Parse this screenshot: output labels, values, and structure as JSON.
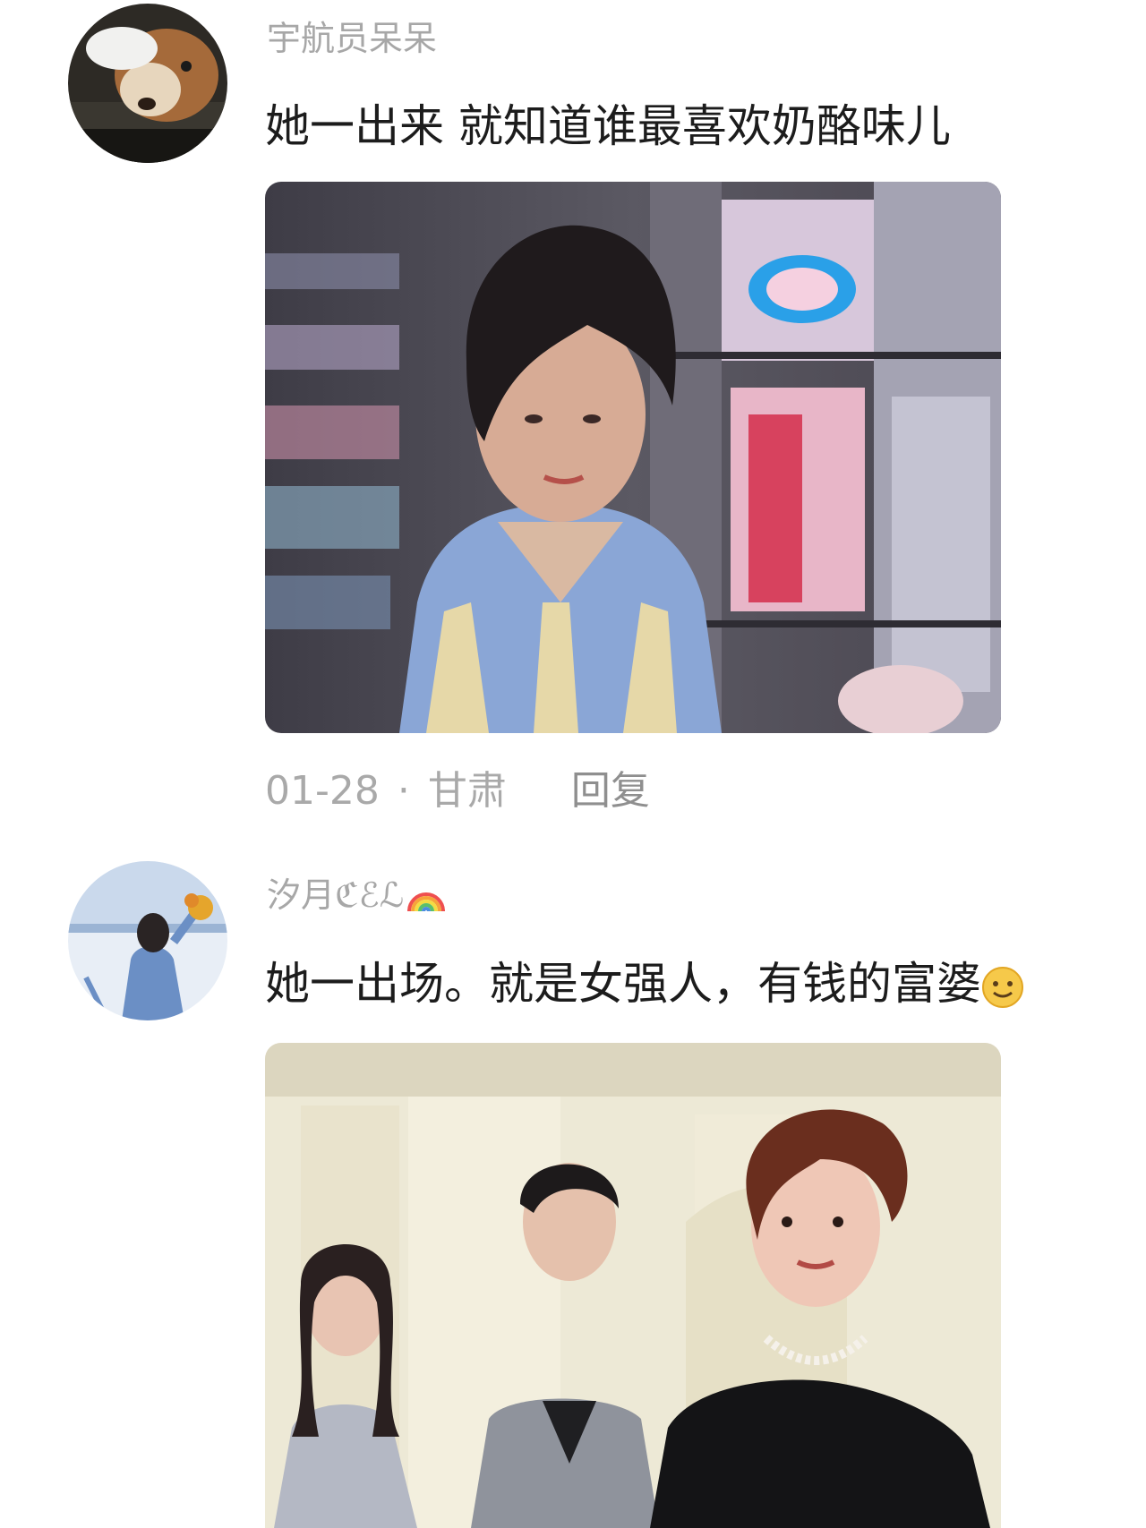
{
  "comments": [
    {
      "username": "宇航员呆呆",
      "avatar_icon": "dog-avatar",
      "text": "她一出来 就知道谁最喜欢奶酪味儿",
      "date": "01-28",
      "separator": "·",
      "location": "甘肃",
      "reply_label": "回复"
    },
    {
      "username": "汐月ℭℰℒ",
      "username_icon": "rainbow-icon",
      "avatar_icon": "girl-with-flowers-avatar",
      "text": "她一出场。就是女强人，有钱的富婆",
      "trailing_icon": "smiling-face-emoji"
    }
  ]
}
